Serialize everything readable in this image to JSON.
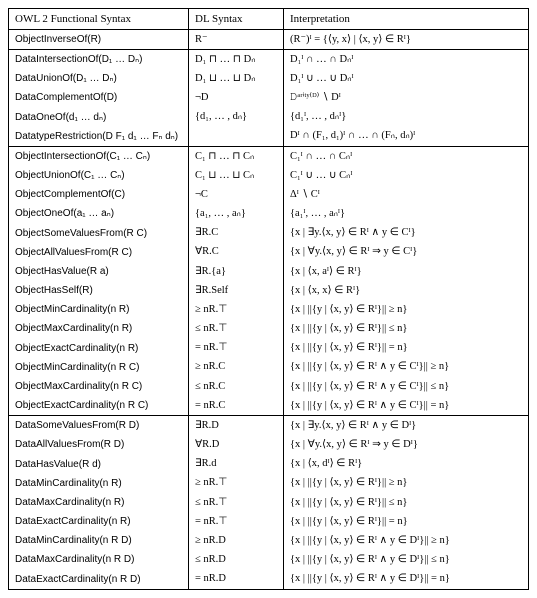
{
  "headers": {
    "col1": "OWL 2 Functional Syntax",
    "col2": "DL Syntax",
    "col3": "Interpretation"
  },
  "groups": [
    {
      "rows": [
        {
          "fn": "ObjectInverseOf(R)",
          "dl": "R⁻",
          "interp": "(R⁻)ᴵ = {⟨y, x⟩ | ⟨x, y⟩ ∈ Rᴵ}"
        }
      ]
    },
    {
      "rows": [
        {
          "fn": "DataIntersectionOf(D₁ … Dₙ)",
          "dl": "D₁ ⊓ … ⊓ Dₙ",
          "interp": "D₁ᴵ ∩ … ∩ Dₙᴵ"
        },
        {
          "fn": "DataUnionOf(D₁ … Dₙ)",
          "dl": "D₁ ⊔ … ⊔ Dₙ",
          "interp": "D₁ᴵ ∪ … ∪ Dₙᴵ"
        },
        {
          "fn": "DataComplementOf(D)",
          "dl": "¬D",
          "interp": "𝙳ᵃʳⁱᵗʸ⁽ᴰ⁾ ∖ Dᴵ"
        },
        {
          "fn": "DataOneOf(d₁ … dₙ)",
          "dl": "{d₁, … , dₙ}",
          "interp": "{d₁ᴵ, … , dₙᴵ}"
        },
        {
          "fn": "DatatypeRestriction(D F₁ d₁ … Fₙ dₙ)",
          "dl": "",
          "interp": "Dᴵ ∩ (F₁, d₁)ᴵ ∩ … ∩ (Fₙ, dₙ)ᴵ"
        }
      ]
    },
    {
      "rows": [
        {
          "fn": "ObjectIntersectionOf(C₁ … Cₙ)",
          "dl": "C₁ ⊓ … ⊓ Cₙ",
          "interp": "C₁ᴵ ∩ … ∩ Cₙᴵ"
        },
        {
          "fn": "ObjectUnionOf(C₁ … Cₙ)",
          "dl": "C₁ ⊔ … ⊔ Cₙ",
          "interp": "C₁ᴵ ∪ … ∪ Cₙᴵ"
        },
        {
          "fn": "ObjectComplementOf(C)",
          "dl": "¬C",
          "interp": "Δᴵ ∖ Cᴵ"
        },
        {
          "fn": "ObjectOneOf(a₁ … aₙ)",
          "dl": "{a₁, … , aₙ}",
          "interp": "{a₁ᴵ, … , aₙᴵ}"
        },
        {
          "fn": "ObjectSomeValuesFrom(R C)",
          "dl": "∃R.C",
          "interp": "{x | ∃y.⟨x, y⟩ ∈ Rᴵ ∧ y ∈ Cᴵ}"
        },
        {
          "fn": "ObjectAllValuesFrom(R C)",
          "dl": "∀R.C",
          "interp": "{x | ∀y.⟨x, y⟩ ∈ Rᴵ ⇒ y ∈ Cᴵ}"
        },
        {
          "fn": "ObjectHasValue(R a)",
          "dl": "∃R.{a}",
          "interp": "{x | ⟨x, aᴵ⟩ ∈ Rᴵ}"
        },
        {
          "fn": "ObjectHasSelf(R)",
          "dl": "∃R.Self",
          "interp": "{x | ⟨x, x⟩ ∈ Rᴵ}"
        },
        {
          "fn": "ObjectMinCardinality(n R)",
          "dl": "≥ nR.⊤",
          "interp": "{x | ||{y | ⟨x, y⟩ ∈ Rᴵ}|| ≥ n}"
        },
        {
          "fn": "ObjectMaxCardinality(n R)",
          "dl": "≤ nR.⊤",
          "interp": "{x | ||{y | ⟨x, y⟩ ∈ Rᴵ}|| ≤ n}"
        },
        {
          "fn": "ObjectExactCardinality(n R)",
          "dl": "= nR.⊤",
          "interp": "{x | ||{y | ⟨x, y⟩ ∈ Rᴵ}|| = n}"
        },
        {
          "fn": "ObjectMinCardinality(n R C)",
          "dl": "≥ nR.C",
          "interp": "{x | ||{y | ⟨x, y⟩ ∈ Rᴵ ∧ y ∈ Cᴵ}|| ≥ n}"
        },
        {
          "fn": "ObjectMaxCardinality(n R C)",
          "dl": "≤ nR.C",
          "interp": "{x | ||{y | ⟨x, y⟩ ∈ Rᴵ ∧ y ∈ Cᴵ}|| ≤ n}"
        },
        {
          "fn": "ObjectExactCardinality(n R C)",
          "dl": "= nR.C",
          "interp": "{x | ||{y | ⟨x, y⟩ ∈ Rᴵ ∧ y ∈ Cᴵ}|| = n}"
        }
      ]
    },
    {
      "rows": [
        {
          "fn": "DataSomeValuesFrom(R D)",
          "dl": "∃R.D",
          "interp": "{x | ∃y.⟨x, y⟩ ∈ Rᴵ ∧ y ∈ Dᴵ}"
        },
        {
          "fn": "DataAllValuesFrom(R D)",
          "dl": "∀R.D",
          "interp": "{x | ∀y.⟨x, y⟩ ∈ Rᴵ ⇒ y ∈ Dᴵ}"
        },
        {
          "fn": "DataHasValue(R d)",
          "dl": "∃R.d",
          "interp": "{x | ⟨x, dᴵ⟩ ∈ Rᴵ}"
        },
        {
          "fn": "DataMinCardinality(n R)",
          "dl": "≥ nR.⊤",
          "interp": "{x | ||{y | ⟨x, y⟩ ∈ Rᴵ}|| ≥ n}"
        },
        {
          "fn": "DataMaxCardinality(n R)",
          "dl": "≤ nR.⊤",
          "interp": "{x | ||{y | ⟨x, y⟩ ∈ Rᴵ}|| ≤ n}"
        },
        {
          "fn": "DataExactCardinality(n R)",
          "dl": "= nR.⊤",
          "interp": "{x | ||{y | ⟨x, y⟩ ∈ Rᴵ}|| = n}"
        },
        {
          "fn": "DataMinCardinality(n R D)",
          "dl": "≥ nR.D",
          "interp": "{x | ||{y | ⟨x, y⟩ ∈ Rᴵ ∧ y ∈ Dᴵ}|| ≥ n}"
        },
        {
          "fn": "DataMaxCardinality(n R D)",
          "dl": "≤ nR.D",
          "interp": "{x | ||{y | ⟨x, y⟩ ∈ Rᴵ ∧ y ∈ Dᴵ}|| ≤ n}"
        },
        {
          "fn": "DataExactCardinality(n R D)",
          "dl": "= nR.D",
          "interp": "{x | ||{y | ⟨x, y⟩ ∈ Rᴵ ∧ y ∈ Dᴵ}|| = n}"
        }
      ]
    }
  ]
}
